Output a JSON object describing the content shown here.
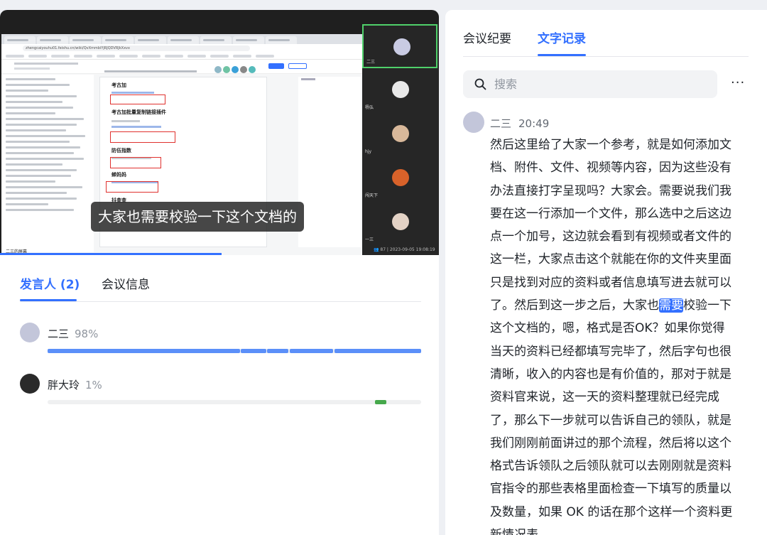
{
  "video": {
    "subtitle": "大家也需要校验一下这个文档的",
    "screen_owner_label": "二三的屏幕",
    "meta": "👥 87  |  2023-09-05 19:08:19",
    "address_url": "zhengcaiyouhu01.feishu.cn/wiki/QvXmmbiYjRJQDVRJkXxvx",
    "doc_sections": [
      "考古加",
      "考古加批量复制链接插件",
      "防伍指数",
      "蝉妈妈",
      "抖查查"
    ],
    "participants": [
      {
        "name": "二三",
        "active": true,
        "color": "#c9cbe3"
      },
      {
        "name": "杨弘",
        "active": false,
        "color": "#e8e8e8"
      },
      {
        "name": "hjy",
        "active": false,
        "color": "#d8b89a"
      },
      {
        "name": "闯天下",
        "active": false,
        "color": "#d8622a"
      },
      {
        "name": "一三",
        "active": false,
        "color": "#e3d2c5"
      }
    ]
  },
  "left_tabs": {
    "speakers": "发言人 (2)",
    "meeting_info": "会议信息"
  },
  "speakers": [
    {
      "name": "二三",
      "percent": "98%",
      "avatar_color": "#c3c6da",
      "segments": [
        [
          0,
          0.515
        ],
        [
          0.518,
          0.585
        ],
        [
          0.588,
          0.645
        ],
        [
          0.648,
          0.765
        ],
        [
          0.768,
          1.0
        ]
      ],
      "bar_color": "#5b8ff9"
    },
    {
      "name": "胖大玲",
      "percent": "1%",
      "avatar_color": "#2a2a2a",
      "segments": [
        [
          0.877,
          0.906
        ]
      ],
      "bar_color": "#45a84b"
    }
  ],
  "right_tabs": {
    "summary": "会议纪要",
    "transcript": "文字记录"
  },
  "search": {
    "placeholder": "搜索"
  },
  "more_label": "···",
  "entry": {
    "speaker": "二三",
    "time": "20:49",
    "text_before": "然后这里给了大家一个参考，就是如何添加文档、附件、文件、视频等内容，因为这些没有办法直接打字呈现吗？大家会。需要说我们我要在这一行添加一个文件，那么选中之后这边点一个加号，这边就会看到有视频或者文件的这一栏，大家点击这个就能在你的文件夹里面只是找到对应的资料或者信息填写进去就可以了。然后到这一步之后，大家也",
    "highlight": "需要",
    "text_after": "校验一下这个文档的，嗯，格式是否OK？如果你觉得当天的资料已经都填写完毕了，然后字句也很清晰，收入的内容也是有价值的，那对于就是资料官来说，这一天的资料整理就已经完成了，那么下一步就可以告诉自己的领队，就是我们刚刚前面讲过的那个流程，然后将以这个格式告诉领队之后领队就可以去刚刚就是资料官指令的那些表格里面检查一下填写的质量以及数量，如果 OK 的话在那个这样一个资料更新情况表"
  }
}
